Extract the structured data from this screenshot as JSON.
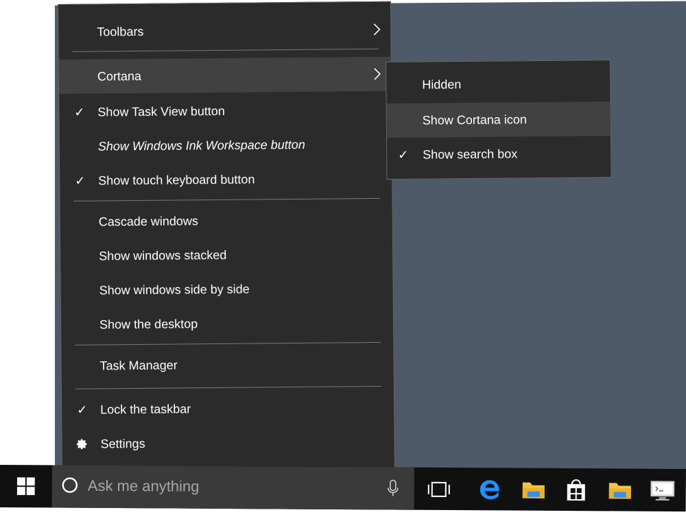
{
  "context_menu": {
    "items": [
      {
        "label": "Toolbars",
        "checked": false,
        "submenu": true,
        "italic": false
      },
      {
        "label": "Cortana",
        "checked": false,
        "submenu": true,
        "italic": false,
        "highlighted": true
      },
      {
        "label": "Show Task View button",
        "checked": true,
        "submenu": false,
        "italic": false
      },
      {
        "label": "Show Windows Ink Workspace button",
        "checked": false,
        "submenu": false,
        "italic": true
      },
      {
        "label": "Show touch keyboard button",
        "checked": true,
        "submenu": false,
        "italic": false
      },
      {
        "label": "Cascade windows",
        "checked": false
      },
      {
        "label": "Show windows stacked",
        "checked": false
      },
      {
        "label": "Show windows side by side",
        "checked": false
      },
      {
        "label": "Show the desktop",
        "checked": false
      },
      {
        "label": "Task Manager",
        "checked": false
      },
      {
        "label": "Lock the taskbar",
        "checked": true
      },
      {
        "label": "Settings",
        "icon": "gear-icon"
      }
    ],
    "check_glyph": "✓"
  },
  "cortana_submenu": {
    "items": [
      {
        "label": "Hidden",
        "checked": false
      },
      {
        "label": "Show Cortana icon",
        "checked": false,
        "highlighted": true
      },
      {
        "label": "Show search box",
        "checked": true
      }
    ]
  },
  "taskbar": {
    "search_placeholder": "Ask me anything",
    "icons": [
      "windows-logo-icon",
      "cortana-ring-icon",
      "microphone-icon",
      "task-view-icon",
      "edge-icon",
      "file-explorer-icon",
      "store-icon",
      "folder-icon",
      "remote-desktop-icon"
    ]
  },
  "colors": {
    "menu_bg": "#2b2b2b",
    "menu_highlight": "#414141",
    "desktop_bg": "#4e5a68",
    "taskbar_bg": "#101010",
    "search_bg": "#3a3a3a",
    "accent_blue": "#1e90ff",
    "folder_yellow": "#f5c342"
  }
}
